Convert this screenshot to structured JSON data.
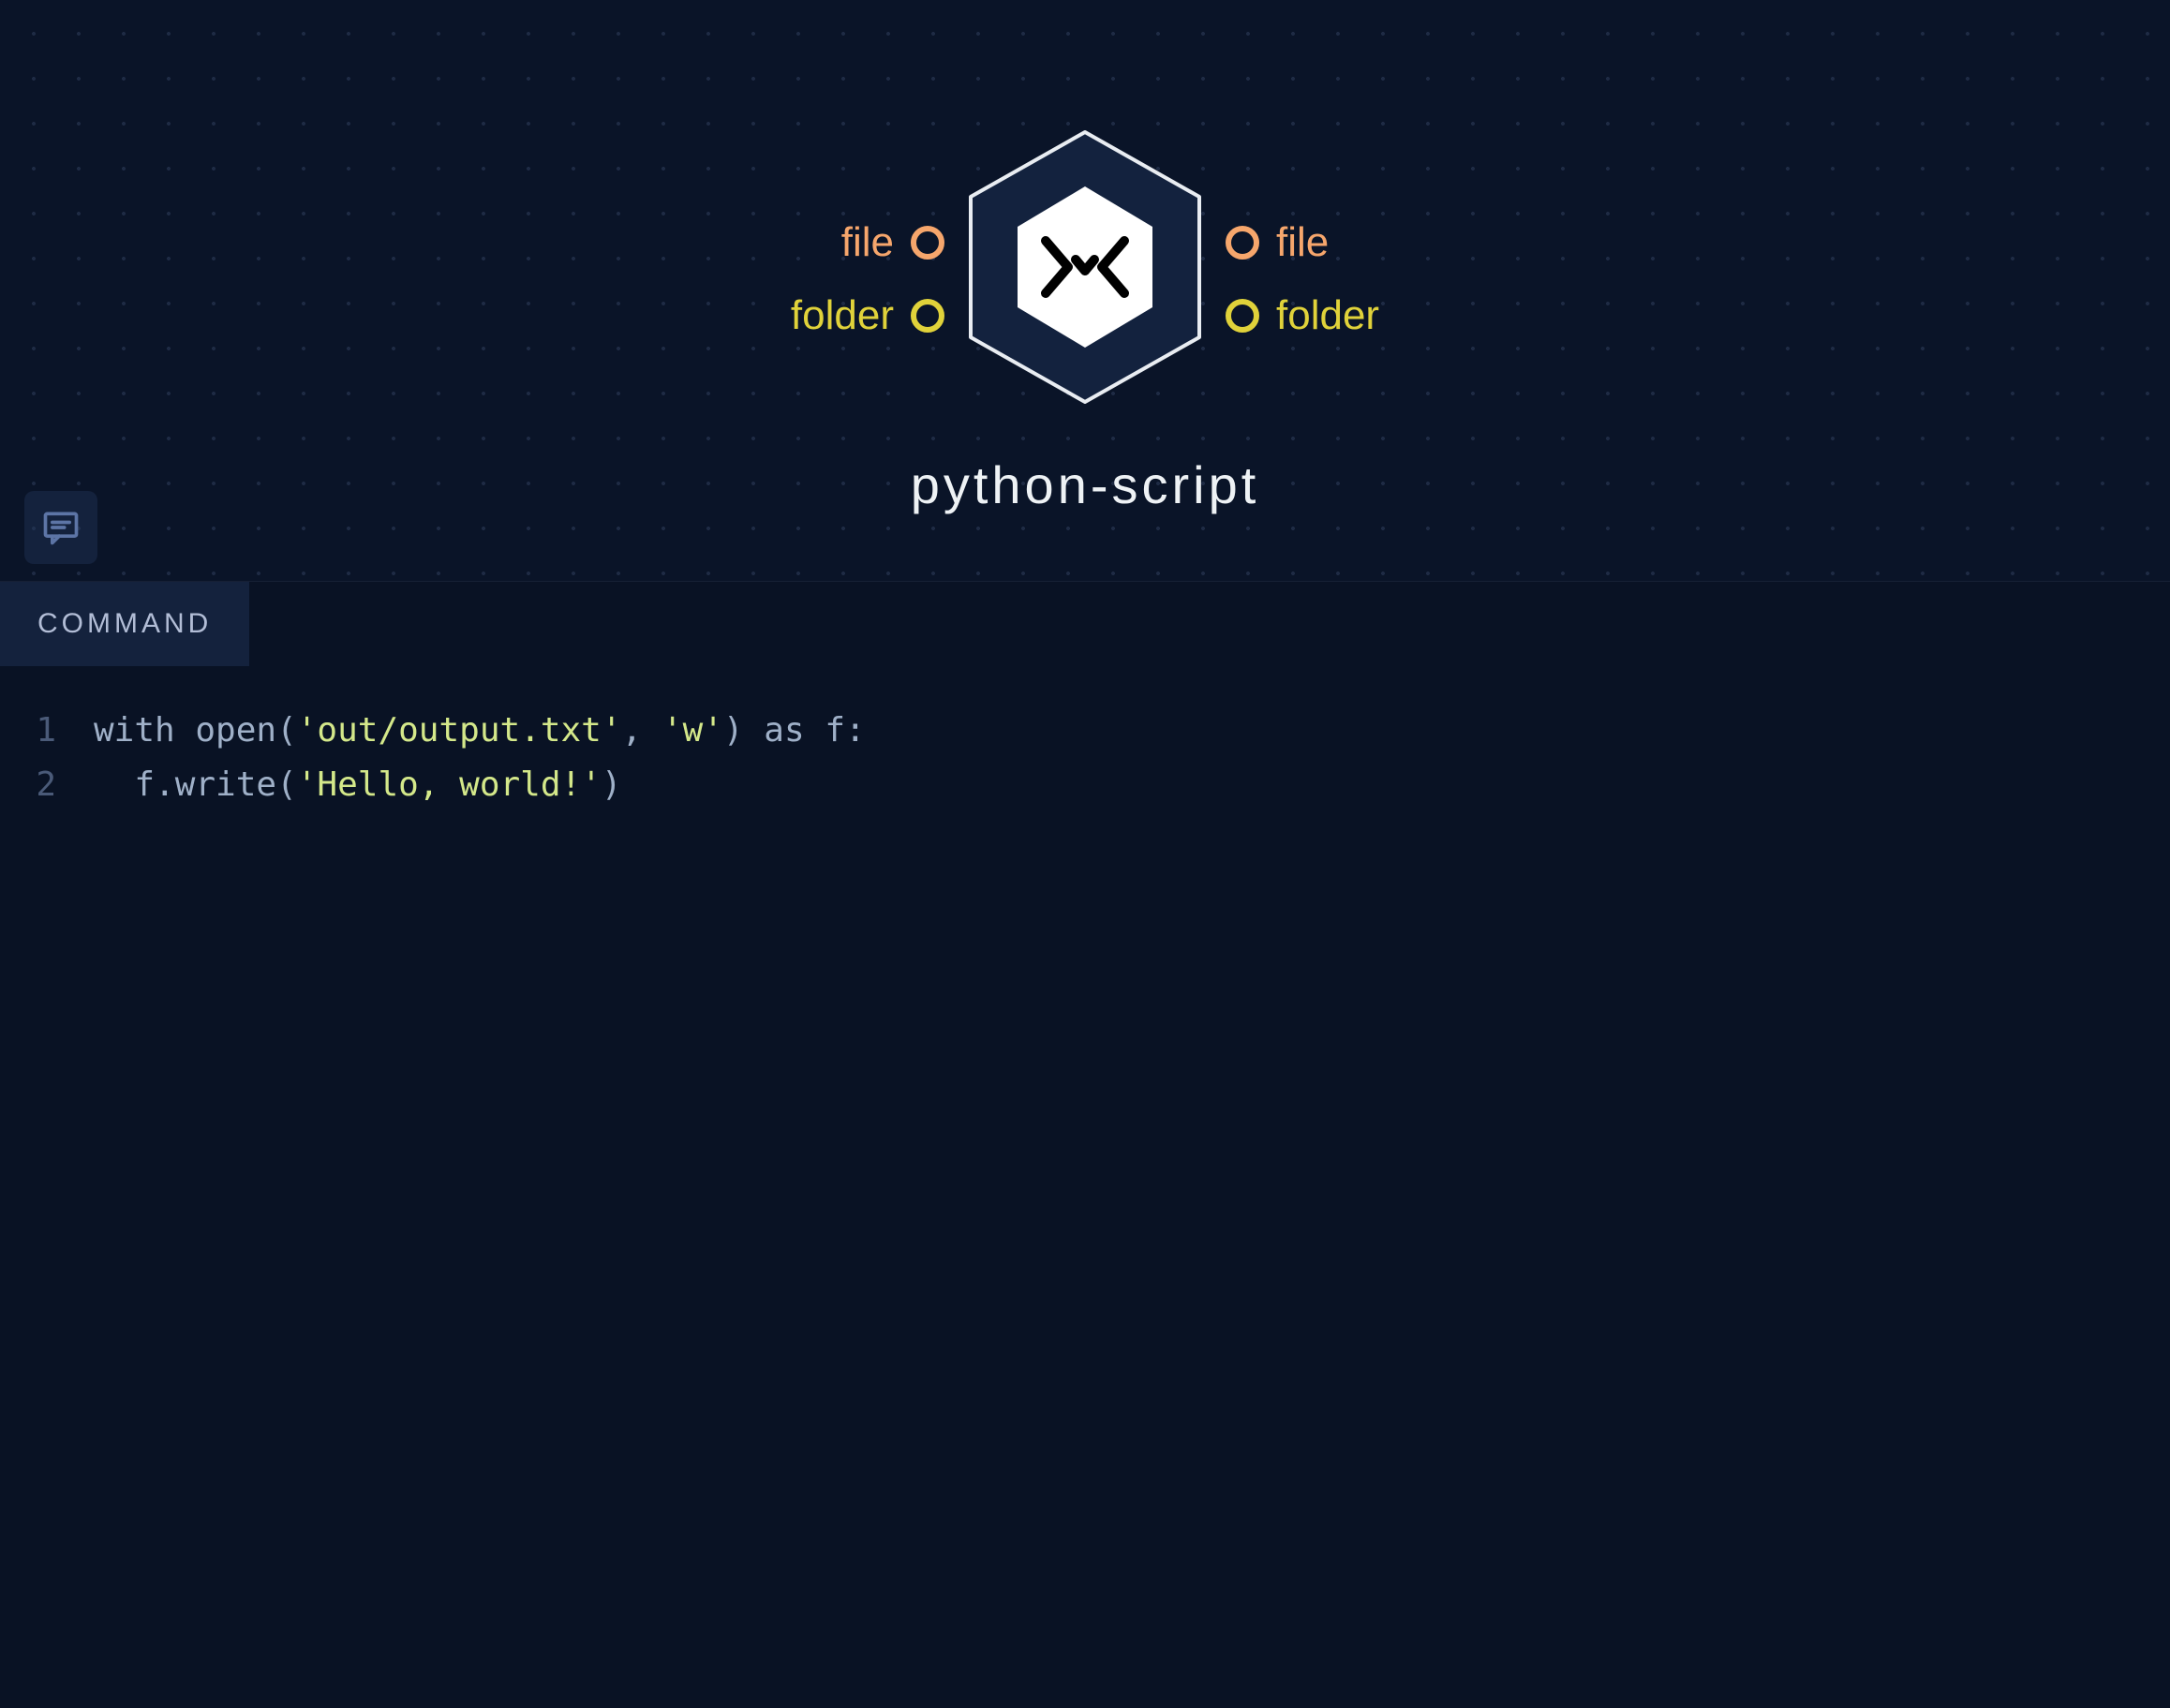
{
  "node": {
    "title": "python-script",
    "icon": "logo-icon",
    "ports": {
      "left": [
        {
          "type": "file",
          "label": "file"
        },
        {
          "type": "folder",
          "label": "folder"
        }
      ],
      "right": [
        {
          "type": "file",
          "label": "file"
        },
        {
          "type": "folder",
          "label": "folder"
        }
      ]
    }
  },
  "comment_button": {
    "icon": "comment-icon"
  },
  "panel": {
    "tabs": [
      {
        "id": "command",
        "label": "COMMAND",
        "active": true
      }
    ],
    "code": {
      "lines": [
        {
          "n": 1,
          "tokens": [
            {
              "t": "with ",
              "c": "kw"
            },
            {
              "t": "open(",
              "c": "fn"
            },
            {
              "t": "'out/output.txt'",
              "c": "str"
            },
            {
              "t": ", ",
              "c": "punc"
            },
            {
              "t": "'w'",
              "c": "str"
            },
            {
              "t": ") ",
              "c": "punc"
            },
            {
              "t": "as",
              "c": "kw"
            },
            {
              "t": " f:",
              "c": "plain"
            }
          ]
        },
        {
          "n": 2,
          "tokens": [
            {
              "t": "  f.write(",
              "c": "fn"
            },
            {
              "t": "'Hello, world!'",
              "c": "str"
            },
            {
              "t": ")",
              "c": "punc"
            }
          ]
        }
      ]
    }
  }
}
